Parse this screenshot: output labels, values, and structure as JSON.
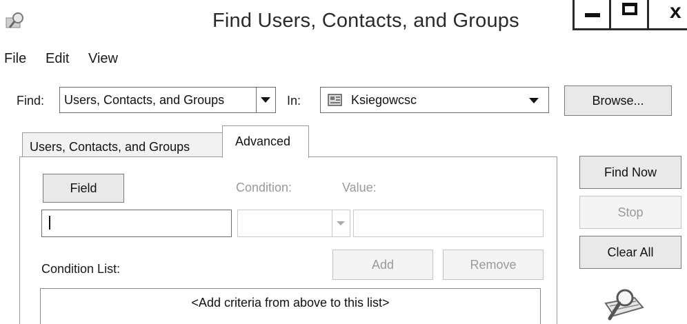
{
  "window": {
    "title": "Find Users, Contacts, and Groups",
    "icon": "find-app-icon",
    "controls": [
      "minimize-icon",
      "maximize-icon",
      "close-icon"
    ],
    "close_glyph": "x"
  },
  "menu": {
    "items": [
      "File",
      "Edit",
      "View"
    ]
  },
  "find_row": {
    "find_label": "Find:",
    "find_value": "Users, Contacts, and Groups",
    "in_label": "In:",
    "in_value": "Ksiegowcsc",
    "in_icon": "domain-icon",
    "browse_label": "Browse..."
  },
  "tabs": {
    "items": [
      "Users, Contacts, and Groups",
      "Advanced"
    ],
    "active": "Advanced"
  },
  "advanced": {
    "field_label": "Field",
    "condition_label": "Condition:",
    "value_label": "Value:",
    "field_value": "",
    "value_value": "",
    "condition_list_label": "Condition List:",
    "add_label": "Add",
    "remove_label": "Remove",
    "criteria_placeholder": "<Add criteria from above to this list>"
  },
  "actions": {
    "find_now_label": "Find Now",
    "stop_label": "Stop",
    "clear_all_label": "Clear All",
    "icon": "search-animation-icon"
  }
}
